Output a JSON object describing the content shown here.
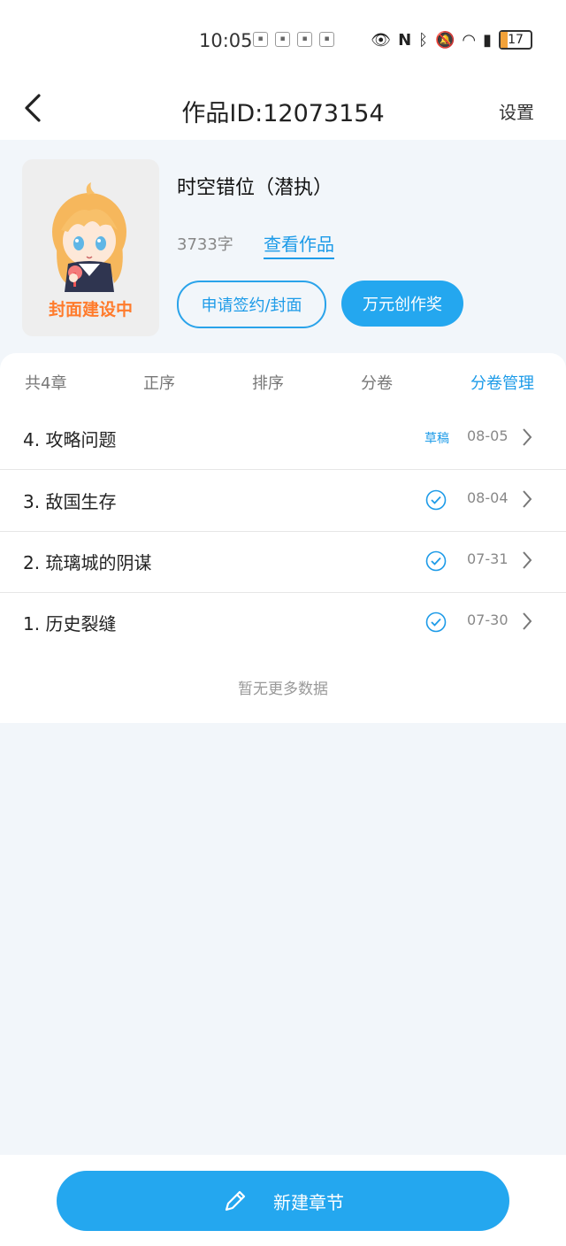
{
  "status": {
    "time": "10:05",
    "battery": "17"
  },
  "header": {
    "title": "作品ID:12073154",
    "settings_label": "设置"
  },
  "work": {
    "title": "时空错位（潜执）",
    "word_count": "3733字",
    "view_link": "查看作品",
    "cover_label": "封面建设中",
    "apply_button": "申请签约/封面",
    "award_button": "万元创作奖"
  },
  "tabs": {
    "count": "共4章",
    "ascending": "正序",
    "sort": "排序",
    "volume": "分卷",
    "volume_manage": "分卷管理"
  },
  "chapters": [
    {
      "name": "4. 攻略问题",
      "status": "草稿",
      "date": "08-05"
    },
    {
      "name": "3. 敌国生存",
      "status": "published",
      "date": "08-04"
    },
    {
      "name": "2. 琉璃城的阴谋",
      "status": "published",
      "date": "07-31"
    },
    {
      "name": "1. 历史裂缝",
      "status": "published",
      "date": "07-30"
    }
  ],
  "footer": {
    "no_more": "暂无更多数据",
    "new_chapter": "新建章节"
  },
  "colors": {
    "accent": "#1d9be8",
    "button": "#24a7ef",
    "cover_label": "#ff7b2c"
  }
}
